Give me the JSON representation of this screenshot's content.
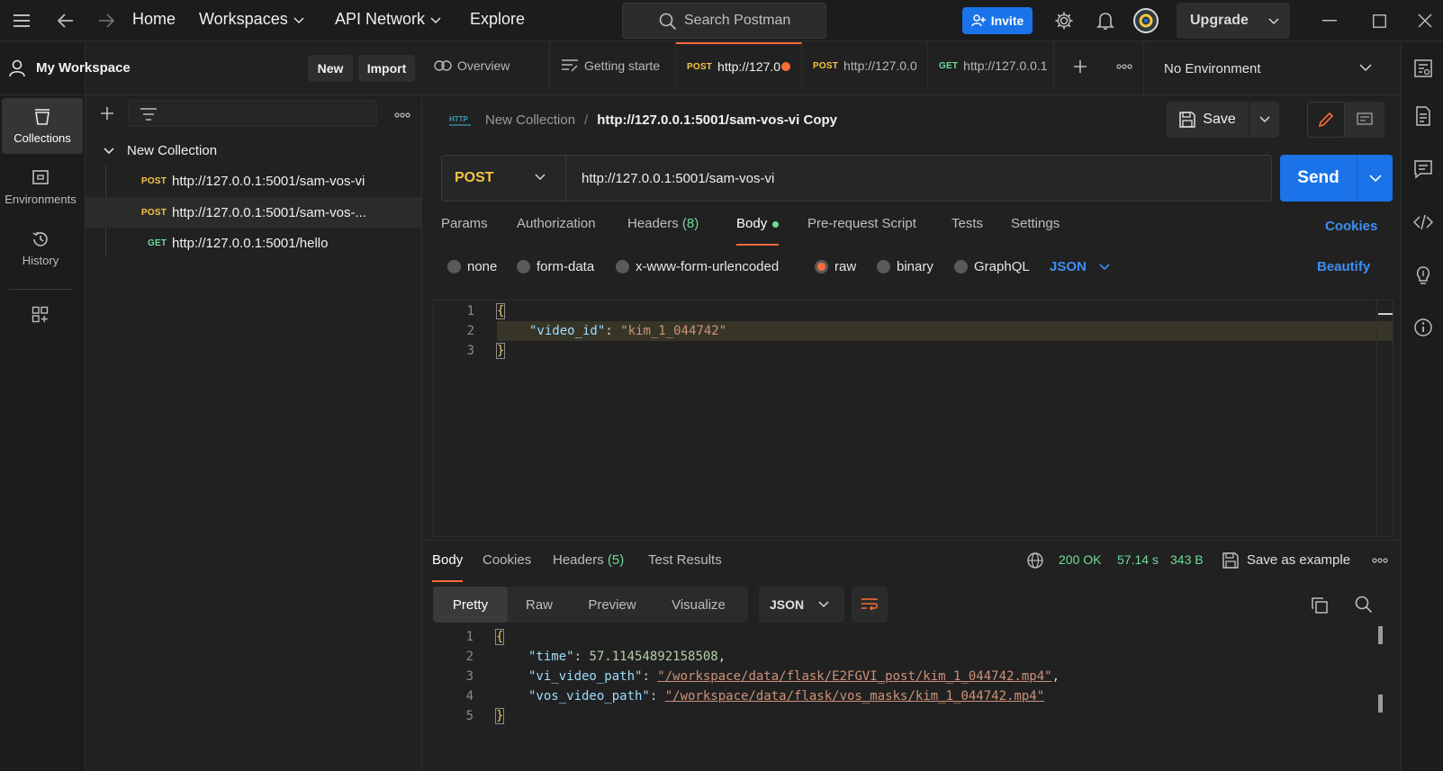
{
  "topbar": {
    "nav": [
      "Home",
      "Workspaces",
      "API Network",
      "Explore"
    ],
    "search_placeholder": "Search Postman",
    "invite_label": "Invite",
    "upgrade_label": "Upgrade"
  },
  "workspace": {
    "title": "My Workspace",
    "new_label": "New",
    "import_label": "Import"
  },
  "rail": [
    {
      "label": "Collections",
      "icon": "collections-icon"
    },
    {
      "label": "Environments",
      "icon": "environments-icon"
    },
    {
      "label": "History",
      "icon": "history-icon"
    }
  ],
  "sidebar": {
    "collection_name": "New Collection",
    "requests": [
      {
        "method": "POST",
        "url": "http://127.0.0.1:5001/sam-vos-vi"
      },
      {
        "method": "POST",
        "url": "http://127.0.0.1:5001/sam-vos-..."
      },
      {
        "method": "GET",
        "url": "http://127.0.0.1:5001/hello"
      }
    ]
  },
  "tabs": [
    {
      "method": "",
      "label": "Overview"
    },
    {
      "method": "",
      "label": "Getting starte"
    },
    {
      "method": "POST",
      "label": "http://127.0"
    },
    {
      "method": "POST",
      "label": "http://127.0.0"
    },
    {
      "method": "GET",
      "label": "http://127.0.0.1"
    }
  ],
  "environment": "No Environment",
  "breadcrumb": {
    "collection": "New Collection",
    "separator": "/",
    "request": "http://127.0.0.1:5001/sam-vos-vi Copy"
  },
  "save_label": "Save",
  "request": {
    "method": "POST",
    "url": "http://127.0.0.1:5001/sam-vos-vi",
    "send_label": "Send"
  },
  "request_tabs": {
    "params": "Params",
    "authorization": "Authorization",
    "headers": "Headers",
    "headers_count": "(8)",
    "body": "Body",
    "prerequest": "Pre-request Script",
    "tests": "Tests",
    "settings": "Settings",
    "cookies": "Cookies"
  },
  "body_types": [
    "none",
    "form-data",
    "x-www-form-urlencoded",
    "raw",
    "binary",
    "GraphQL"
  ],
  "body_format": "JSON",
  "beautify_label": "Beautify",
  "request_body": {
    "line_numbers": [
      "1",
      "2",
      "3"
    ],
    "open": "{",
    "key": "\"video_id\"",
    "colon": ": ",
    "value": "\"kim_1_044742\"",
    "close": "}"
  },
  "response_tabs": {
    "body": "Body",
    "cookies": "Cookies",
    "headers": "Headers",
    "headers_count": "(5)",
    "test_results": "Test Results"
  },
  "response_status": {
    "status": "200 OK",
    "time": "57.14 s",
    "size": "343 B",
    "save_example": "Save as example"
  },
  "response_formats": [
    "Pretty",
    "Raw",
    "Preview",
    "Visualize"
  ],
  "response_format_type": "JSON",
  "response_body": {
    "line_numbers": [
      "1",
      "2",
      "3",
      "4",
      "5"
    ],
    "open": "{",
    "time_key": "\"time\"",
    "time_value": "57.11454892158508",
    "vi_key": "\"vi_video_path\"",
    "vi_value": "\"/workspace/data/flask/E2FGVI_post/kim_1_044742.mp4\"",
    "vos_key": "\"vos_video_path\"",
    "vos_value": "\"/workspace/data/flask/vos_masks/kim_1_044742.mp4\"",
    "close": "}"
  }
}
